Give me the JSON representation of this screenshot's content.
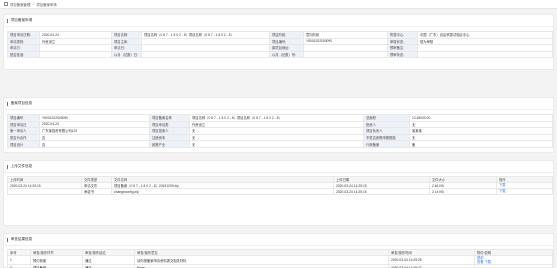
{
  "breadcrumb": {
    "parent": "项目备案管理",
    "current": "项目备案申请"
  },
  "basic_info": {
    "title": "项目备案申请",
    "rows": [
      [
        {
          "t": "项目申请日期:",
          "l": true
        },
        {
          "t": "2020-04-24"
        },
        {
          "t": "项目名称:",
          "l": true
        },
        {
          "t": "项目名称（0 8 7 - 1 8 0 2 - 8）项目名称（0 8 7 - 1 8 0 2 - 8）"
        },
        {
          "t": "项目阶段:",
          "l": true
        },
        {
          "t": "意向阶段"
        },
        {
          "t": "所属中心:",
          "l": true
        },
        {
          "t": "中国（广东）自由贸易试验区中心"
        }
      ],
      [
        {
          "t": "申请类别:",
          "l": true
        },
        {
          "t": "外资设立"
        },
        {
          "t": "项目主体:",
          "l": true
        },
        {
          "t": ""
        },
        {
          "t": "项目编号:",
          "l": true
        },
        {
          "t": "Y5001202000090"
        },
        {
          "t": "审核状态:",
          "l": true
        },
        {
          "t": "现为审核"
        }
      ],
      [
        {
          "t": "申请方:",
          "l": true
        },
        {
          "t": ""
        },
        {
          "t": "申请日:",
          "l": true
        },
        {
          "t": ""
        },
        {
          "t": "原项目地址:",
          "l": true
        },
        {
          "t": ""
        },
        {
          "t": "预审备注:",
          "l": true
        },
        {
          "t": ""
        }
      ],
      [
        {
          "t": "是否批准:",
          "l": true
        },
        {
          "t": ""
        },
        {
          "t": "以月（记数）日:",
          "l": true
        },
        {
          "t": ""
        },
        {
          "t": "以月（记数）号:",
          "l": true
        },
        {
          "t": ""
        },
        {
          "t": "预审状态:",
          "l": true
        },
        {
          "t": ""
        }
      ]
    ]
  },
  "filing_info": {
    "title": "备案项目信息",
    "rows": [
      [
        {
          "t": "项目编号",
          "l": true
        },
        {
          "t": "Y5001202000090"
        },
        {
          "t": "项目备案名称",
          "l": true
        },
        {
          "t": "项目名称（0 8 7 - 1 8 0 2 - 8）项目名称（0 8 7 - 1 8 0 2 - 8）"
        },
        {
          "t": "总面积",
          "l": true
        },
        {
          "t": "12.45000.00"
        }
      ],
      [
        {
          "t": "项目申请日",
          "l": true
        },
        {
          "t": "2020-04-24"
        },
        {
          "t": "项目申请类",
          "l": true
        },
        {
          "t": "外资设立"
        },
        {
          "t": "投资人",
          "l": true
        },
        {
          "t": "无"
        }
      ],
      [
        {
          "t": "第一申请人",
          "l": true
        },
        {
          "t": "广东某投资有限公司123"
        },
        {
          "t": "项目投资人",
          "l": true
        },
        {
          "t": "无"
        },
        {
          "t": "项目负责人",
          "l": true
        },
        {
          "t": "某某某"
        }
      ],
      [
        {
          "t": "是否为合作",
          "l": true
        },
        {
          "t": "否"
        },
        {
          "t": "注册资本",
          "l": true
        },
        {
          "t": "无"
        },
        {
          "t": "不是否参照申报框架",
          "l": true
        },
        {
          "t": "无"
        }
      ],
      [
        {
          "t": "项目设计",
          "l": true
        },
        {
          "t": "否"
        },
        {
          "t": "政策产业",
          "l": true
        },
        {
          "t": "无"
        },
        {
          "t": "行政备案",
          "l": true
        },
        {
          "t": "备"
        }
      ]
    ]
  },
  "attachments": {
    "title": "上传文件信息",
    "headers": [
      "上传时间",
      "文件类型",
      "文件名称",
      "上传日期",
      "文件大小",
      "操作"
    ],
    "rows": [
      [
        "2020-03-24 14:25:15",
        "申请文件",
        "项目备案（0 8 7 - 1 8 0 2 - 8）20191209.zip",
        "2020-03-24 14:25:15",
        "2.64 KB",
        "下载"
      ],
      [
        "",
        "承诺书",
        "changeconfig.zip",
        "2020-03-24 14:25:15",
        "2.14 KB",
        "下载"
      ]
    ]
  },
  "review": {
    "title": "审查结果信息",
    "headers": [
      "序号",
      "审查/操作环节",
      "审查/操作结论",
      "审查/操作意见",
      "审查/操作时间",
      "附件/说明"
    ],
    "rows": [
      [
        "1",
        "预约到案",
        "通过",
        "请你按备案申请资料提交相关材料",
        "2020-03-04 14:25:25",
        "提前\n查看 下载"
      ],
      [
        "2",
        "项目备案",
        "通过",
        "Page",
        "2020-03-04 14:25:27",
        ""
      ]
    ]
  }
}
